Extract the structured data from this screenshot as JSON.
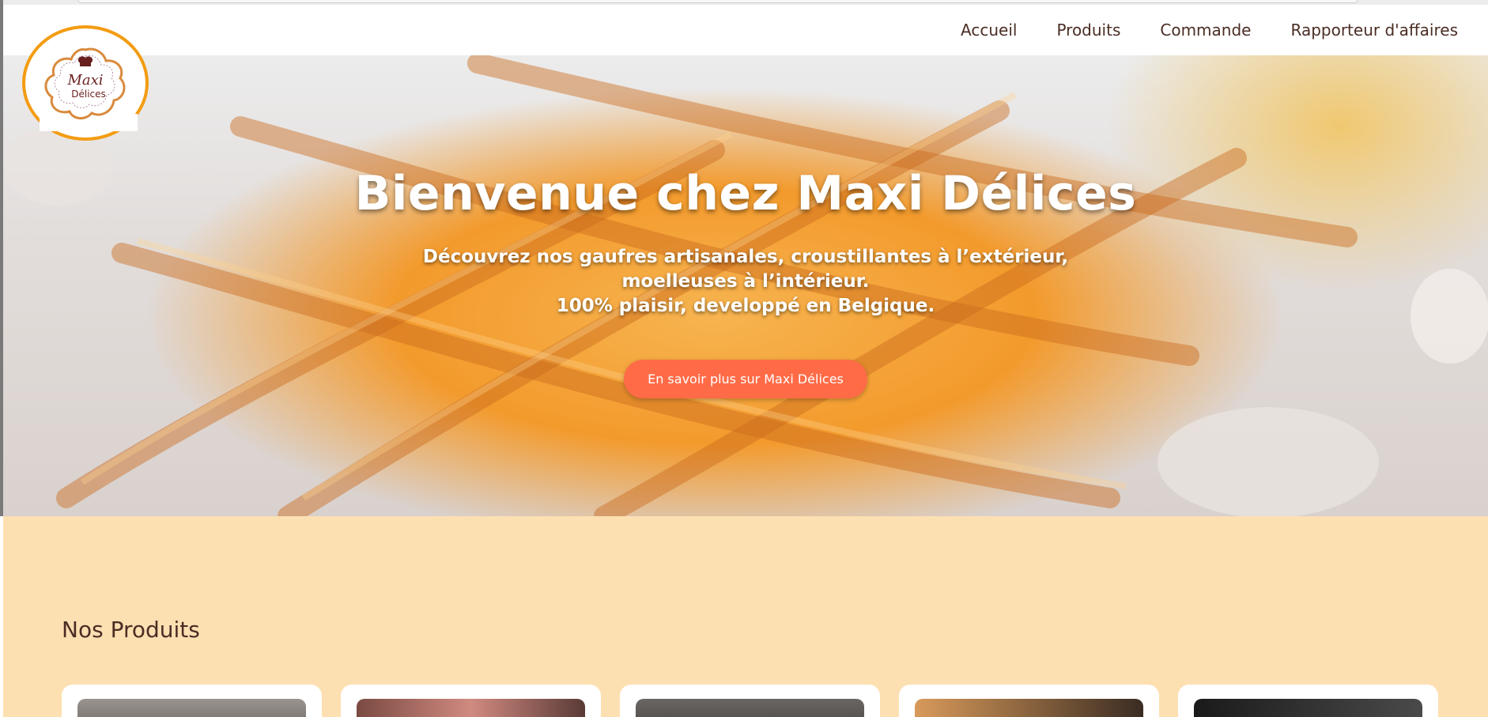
{
  "nav": {
    "links": [
      "Accueil",
      "Produits",
      "Commande",
      "Rapporteur d'affaires"
    ]
  },
  "logo": {
    "line1": "Maxi",
    "line2": "Délices",
    "ring_color": "#f39c12"
  },
  "hero": {
    "title": "Bienvenue chez Maxi Délices",
    "subtitle_lines": [
      "Découvrez nos gaufres artisanales, croustillantes à l’extérieur,",
      "moelleuses à l’intérieur.",
      "100% plaisir, developpé en Belgique."
    ],
    "button_label": "En savoir plus sur Maxi Délices",
    "button_color": "#ff6b47"
  },
  "products": {
    "title": "Nos Produits",
    "background_color": "#fde0b2",
    "cards": [
      {
        "image_tone": "#8a8480"
      },
      {
        "image_tone": "#6b4a44"
      },
      {
        "image_tone": "#5a5654"
      },
      {
        "image_tone": "#b07a45"
      },
      {
        "image_tone": "#2a2a2a"
      }
    ]
  }
}
